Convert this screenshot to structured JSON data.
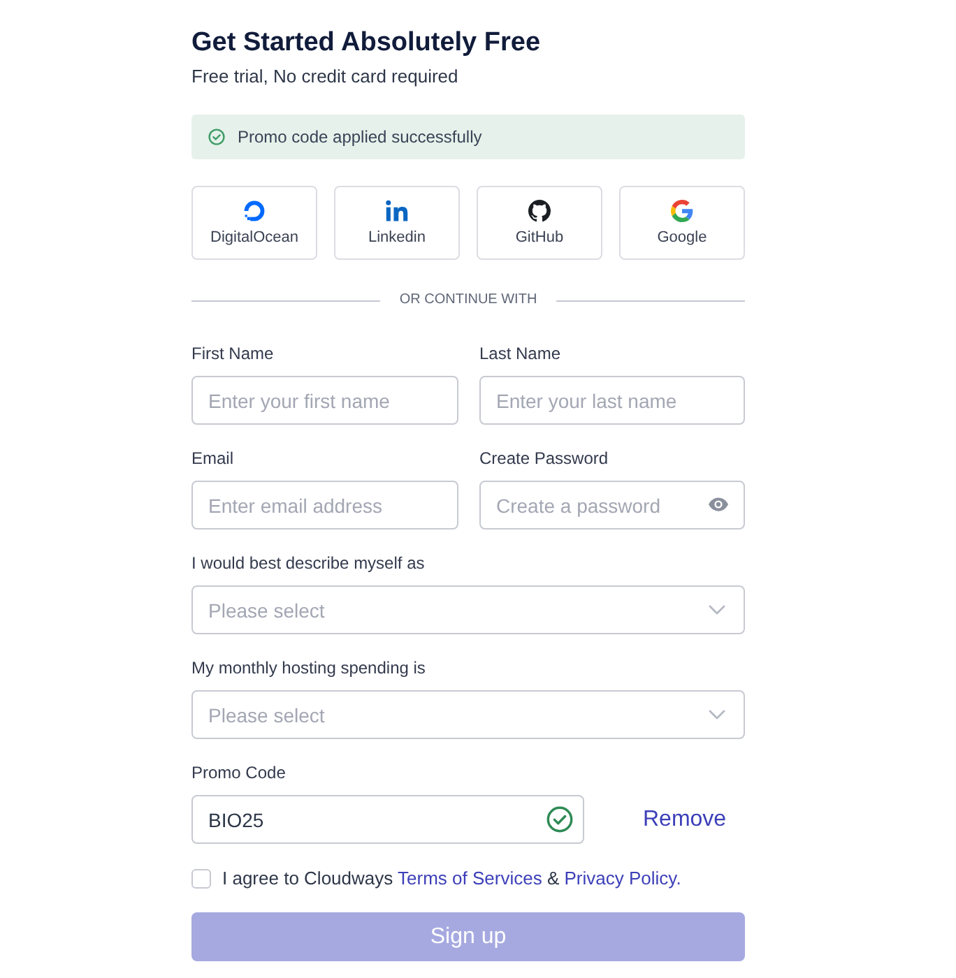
{
  "header": {
    "title": "Get Started Absolutely Free",
    "subtitle": "Free trial, No credit card required"
  },
  "alert": {
    "kind": "success",
    "text": "Promo code applied successfully"
  },
  "social_buttons": [
    {
      "kind": "digitalocean",
      "label": "DigitalOcean"
    },
    {
      "kind": "linkedin",
      "label": "Linkedin"
    },
    {
      "kind": "github",
      "label": "GitHub"
    },
    {
      "kind": "google",
      "label": "Google"
    }
  ],
  "divider": {
    "text": "OR CONTINUE WITH"
  },
  "fields": [
    {
      "kind": "text",
      "label": "First Name",
      "placeholder": "Enter your first name"
    },
    {
      "kind": "text",
      "label": "Last Name",
      "placeholder": "Enter your last name"
    },
    {
      "kind": "text",
      "label": "Email",
      "placeholder": "Enter email address"
    },
    {
      "kind": "password",
      "label": "Create Password",
      "placeholder": "Create a password"
    },
    {
      "kind": "select",
      "label": "I would best describe myself as",
      "placeholder": "Please select"
    },
    {
      "kind": "select",
      "label": "My monthly hosting spending is",
      "placeholder": "Please select"
    },
    {
      "kind": "promo",
      "label": "Promo Code",
      "value": "BIO25",
      "valid": true,
      "action": "Remove"
    }
  ],
  "agreement": {
    "checked": false,
    "segments": [
      {
        "kind": "text",
        "text": "I agree to Cloudways"
      },
      {
        "kind": "link",
        "text": "Terms of Services"
      },
      {
        "kind": "text",
        "text": "&"
      },
      {
        "kind": "link",
        "text": "Privacy Policy."
      }
    ]
  },
  "submit": {
    "label": "Sign up",
    "disabled": true
  }
}
